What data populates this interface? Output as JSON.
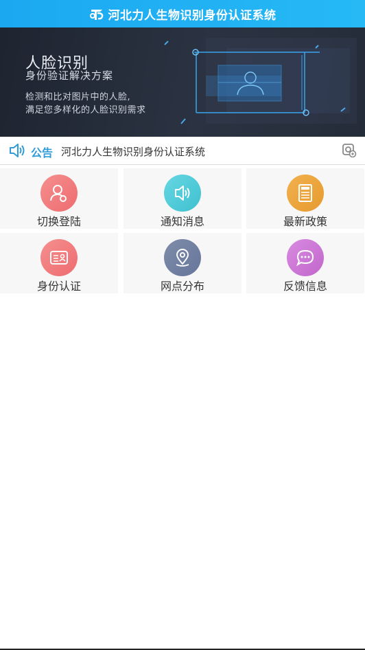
{
  "header": {
    "title": "河北力人生物识别身份认证系统",
    "background": "#1ba8f0"
  },
  "banner": {
    "title": "人脸识别",
    "subtitle": "身份验证解决方案",
    "desc_line1": "检测和比对图片中的人脸,",
    "desc_line2": "满足您多样化的人脸识别需求"
  },
  "notice": {
    "label": "公告",
    "text": "河北力人生物识别身份认证系统",
    "label_color": "#2f9bd8"
  },
  "menu": [
    {
      "label": "切换登陆",
      "icon": "user-switch-icon",
      "color": "#f07a7c"
    },
    {
      "label": "通知消息",
      "icon": "speaker-icon",
      "color": "#4ccad8"
    },
    {
      "label": "最新政策",
      "icon": "news-icon",
      "color": "#eea33c"
    },
    {
      "label": "身份认证",
      "icon": "id-card-icon",
      "color": "#f07a7c"
    },
    {
      "label": "网点分布",
      "icon": "location-pin-icon",
      "color": "#6f7f9c"
    },
    {
      "label": "反馈信息",
      "icon": "chat-bubble-icon",
      "color": "#cd7ad5"
    }
  ]
}
